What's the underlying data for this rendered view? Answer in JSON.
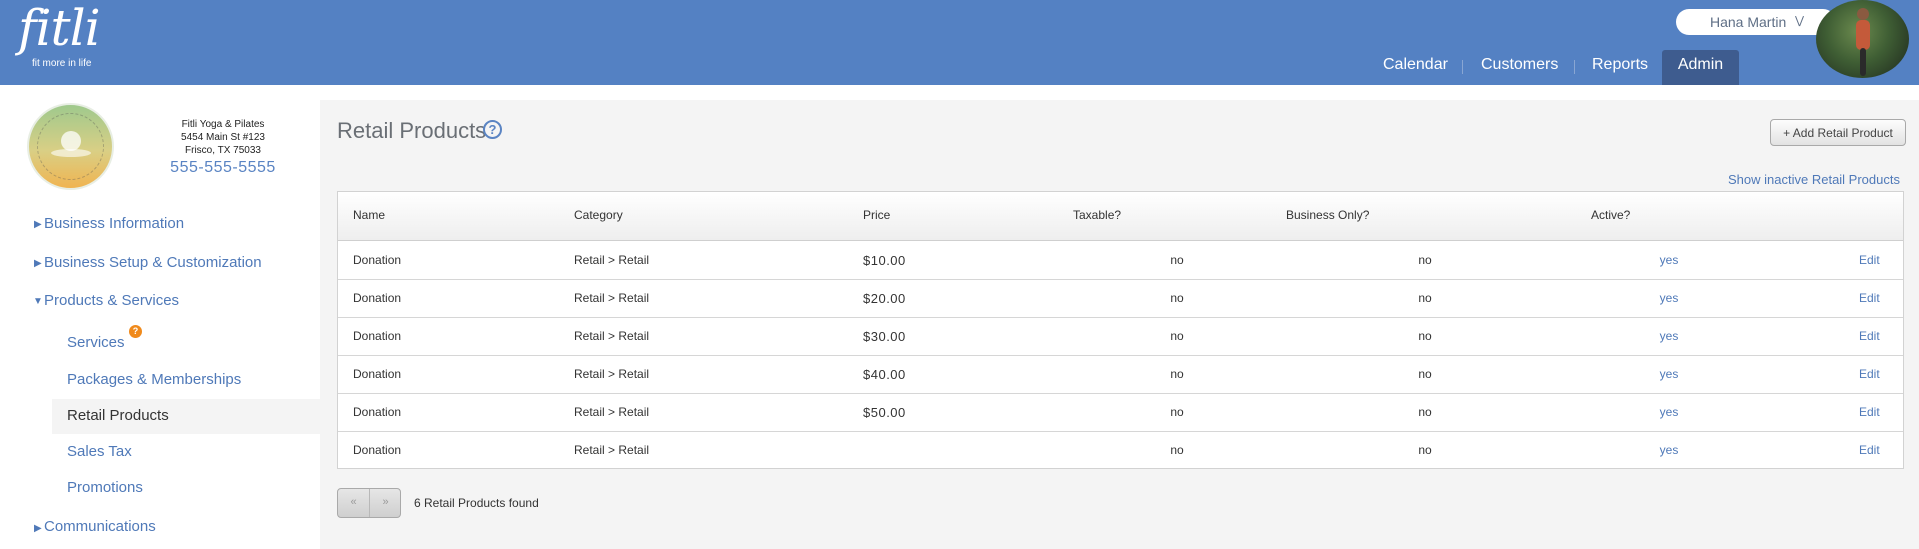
{
  "brand": {
    "logo_text": "fitli",
    "tagline": "fit more in life"
  },
  "user": {
    "name": "Hana Martin",
    "chevron_icon": "chevron-double-down-icon",
    "avatar_icon": "user-avatar-photo"
  },
  "nav": {
    "items": [
      "Calendar",
      "Customers",
      "Reports",
      "Admin"
    ],
    "active": "Admin"
  },
  "business": {
    "logo_icon": "yoga-studio-logo",
    "name": "Fitli Yoga & Pilates",
    "address1": "5454 Main St #123",
    "address2": "Frisco, TX 75033",
    "phone": "555-555-5555"
  },
  "sidebar": {
    "sections": [
      {
        "label": "Business Information",
        "expanded": false
      },
      {
        "label": "Business Setup & Customization",
        "expanded": false
      },
      {
        "label": "Products & Services",
        "expanded": true
      },
      {
        "label": "Communications",
        "expanded": false
      }
    ],
    "subitems": [
      "Services",
      "Packages & Memberships",
      "Retail Products",
      "Sales Tax",
      "Promotions"
    ],
    "active_subitem": "Retail Products",
    "services_badge": "?"
  },
  "page": {
    "title": "Retail Products",
    "help_icon": "?",
    "add_button": "+ Add Retail Product",
    "show_inactive": "Show inactive Retail Products"
  },
  "table": {
    "headers": [
      "Name",
      "Category",
      "Price",
      "Taxable?",
      "Business Only?",
      "Active?"
    ],
    "rows": [
      {
        "name": "Donation",
        "category": "Retail > Retail",
        "price": "$10.00",
        "taxable": "no",
        "business_only": "no",
        "active": "yes",
        "action": "Edit"
      },
      {
        "name": "Donation",
        "category": "Retail > Retail",
        "price": "$20.00",
        "taxable": "no",
        "business_only": "no",
        "active": "yes",
        "action": "Edit"
      },
      {
        "name": "Donation",
        "category": "Retail > Retail",
        "price": "$30.00",
        "taxable": "no",
        "business_only": "no",
        "active": "yes",
        "action": "Edit"
      },
      {
        "name": "Donation",
        "category": "Retail > Retail",
        "price": "$40.00",
        "taxable": "no",
        "business_only": "no",
        "active": "yes",
        "action": "Edit"
      },
      {
        "name": "Donation",
        "category": "Retail > Retail",
        "price": "$50.00",
        "taxable": "no",
        "business_only": "no",
        "active": "yes",
        "action": "Edit"
      },
      {
        "name": "Donation",
        "category": "Retail > Retail",
        "price": "",
        "taxable": "no",
        "business_only": "no",
        "active": "yes",
        "action": "Edit"
      }
    ]
  },
  "pager": {
    "prev": "«",
    "next": "»",
    "found_text": "6 Retail Products found"
  },
  "colors": {
    "header_bg": "#5481c3",
    "nav_active_bg": "#3e5c8f",
    "link": "#4f79b8",
    "panel_bg": "#f4f4f4",
    "badge": "#f08a1c"
  }
}
